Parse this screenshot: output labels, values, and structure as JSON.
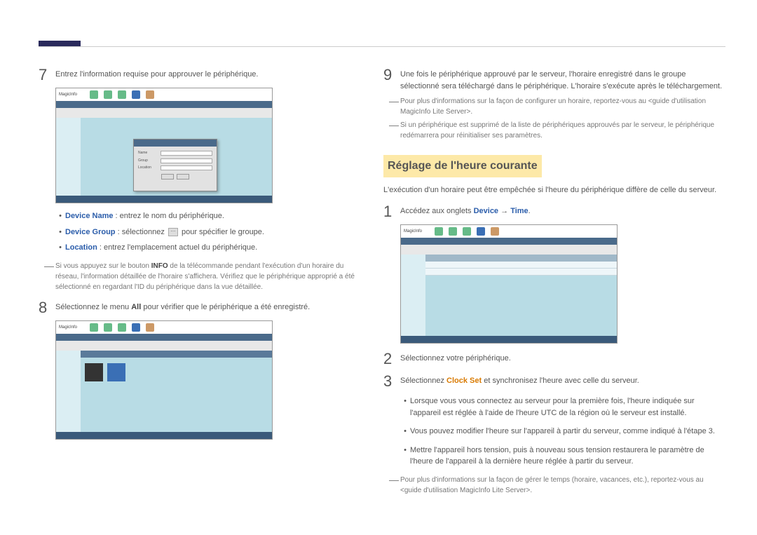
{
  "header": {},
  "left_column": {
    "step7": {
      "num": "7",
      "text": "Entrez l'information requise pour approuver le périphérique."
    },
    "screenshot1": {
      "brand": "MagicInfo",
      "dialog_rows": [
        "Name",
        "Group",
        "Location"
      ],
      "ok": "OK",
      "cancel": "Cancel"
    },
    "bullets7": [
      {
        "label": "Device Name",
        "text": " : entrez le nom du périphérique."
      },
      {
        "label": "Device Group",
        "text": " : sélectionnez ",
        "btn": "⋯",
        "text2": " pour spécifier le groupe."
      },
      {
        "label": "Location",
        "text": " : entrez l'emplacement actuel du périphérique."
      }
    ],
    "note7": {
      "pre": "Si vous appuyez sur le bouton ",
      "bold": "INFO",
      "post": " de la télécommande pendant l'exécution d'un horaire du réseau, l'information détaillée de l'horaire s'affichera. Vérifiez que le périphérique approprié a été sélectionné en regardant l'ID du périphérique dans la vue détaillée."
    },
    "step8": {
      "num": "8",
      "pre": "Sélectionnez le menu ",
      "bold": "All",
      "post": " pour vérifier que le périphérique a été enregistré."
    },
    "screenshot2": {
      "brand": "MagicInfo"
    }
  },
  "right_column": {
    "step9": {
      "num": "9",
      "text": "Une fois le périphérique approuvé par le serveur, l'horaire enregistré dans le groupe sélectionné sera téléchargé dans le périphérique. L'horaire s'exécute après le téléchargement."
    },
    "note9a": "Pour plus d'informations sur la façon de configurer un horaire, reportez-vous au <guide d'utilisation MagicInfo Lite Server>.",
    "note9b": "Si un périphérique est supprimé de la liste de périphériques approuvés par le serveur, le périphérique redémarrera pour réinitialiser ses paramètres.",
    "heading": "Réglage de l'heure courante",
    "intro": "L'exécution d'un horaire peut être empêchée si l'heure du périphérique diffère de celle du serveur.",
    "step1": {
      "num": "1",
      "pre": "Accédez aux onglets ",
      "blue1": "Device",
      "arrow": " → ",
      "blue2": "Time",
      "post": "."
    },
    "screenshot3": {
      "brand": "MagicInfo"
    },
    "step2": {
      "num": "2",
      "text": "Sélectionnez votre périphérique."
    },
    "step3": {
      "num": "3",
      "pre": "Sélectionnez ",
      "orange": "Clock Set",
      "post": " et synchronisez l'heure avec celle du serveur."
    },
    "bullets3": [
      "Lorsque vous vous connectez au serveur pour la première fois, l'heure indiquée sur l'appareil est réglée à l'aide de l'heure UTC de la région où le serveur est installé.",
      "Vous pouvez modifier l'heure sur l'appareil à partir du serveur, comme indiqué à l'étape 3.",
      "Mettre l'appareil hors tension, puis à nouveau sous tension restaurera le paramètre de l'heure de l'appareil à la dernière heure réglée à partir du serveur."
    ],
    "note_end": "Pour plus d'informations sur la façon de gérer le temps (horaire, vacances, etc.), reportez-vous au <guide d'utilisation MagicInfo Lite Server>."
  }
}
